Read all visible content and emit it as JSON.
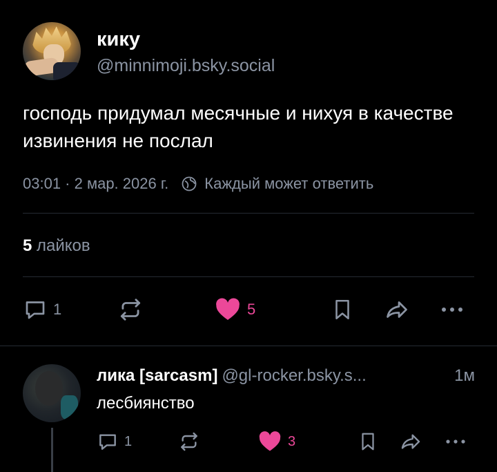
{
  "post": {
    "display_name": "кику",
    "handle": "@minnimoji.bsky.social",
    "text": "господь придумал месячные и нихуя в качестве извинения не послал",
    "time": "03:01 · 2 мар. 2026 г.",
    "reply_setting": "Каждый может ответить",
    "likes_count": "5",
    "likes_label": "лайков",
    "actions": {
      "replies": "1",
      "reposts": "",
      "likes": "5"
    }
  },
  "reply": {
    "display_name": "лика [sarcasm]",
    "handle": "@gl-rocker.bsky.s...",
    "time": "1м",
    "text": "лесбиянство",
    "actions": {
      "replies": "1",
      "reposts": "",
      "likes": "3"
    }
  },
  "icons": {
    "reply": "speech-bubble-icon",
    "repost": "repost-arrows-icon",
    "like": "heart-icon",
    "bookmark": "bookmark-icon",
    "share": "share-arrow-icon",
    "more": "more-dots-icon",
    "globe": "globe-icon"
  },
  "colors": {
    "accent_like": "#ec4899",
    "muted": "#8b94a3",
    "background": "#000000"
  }
}
